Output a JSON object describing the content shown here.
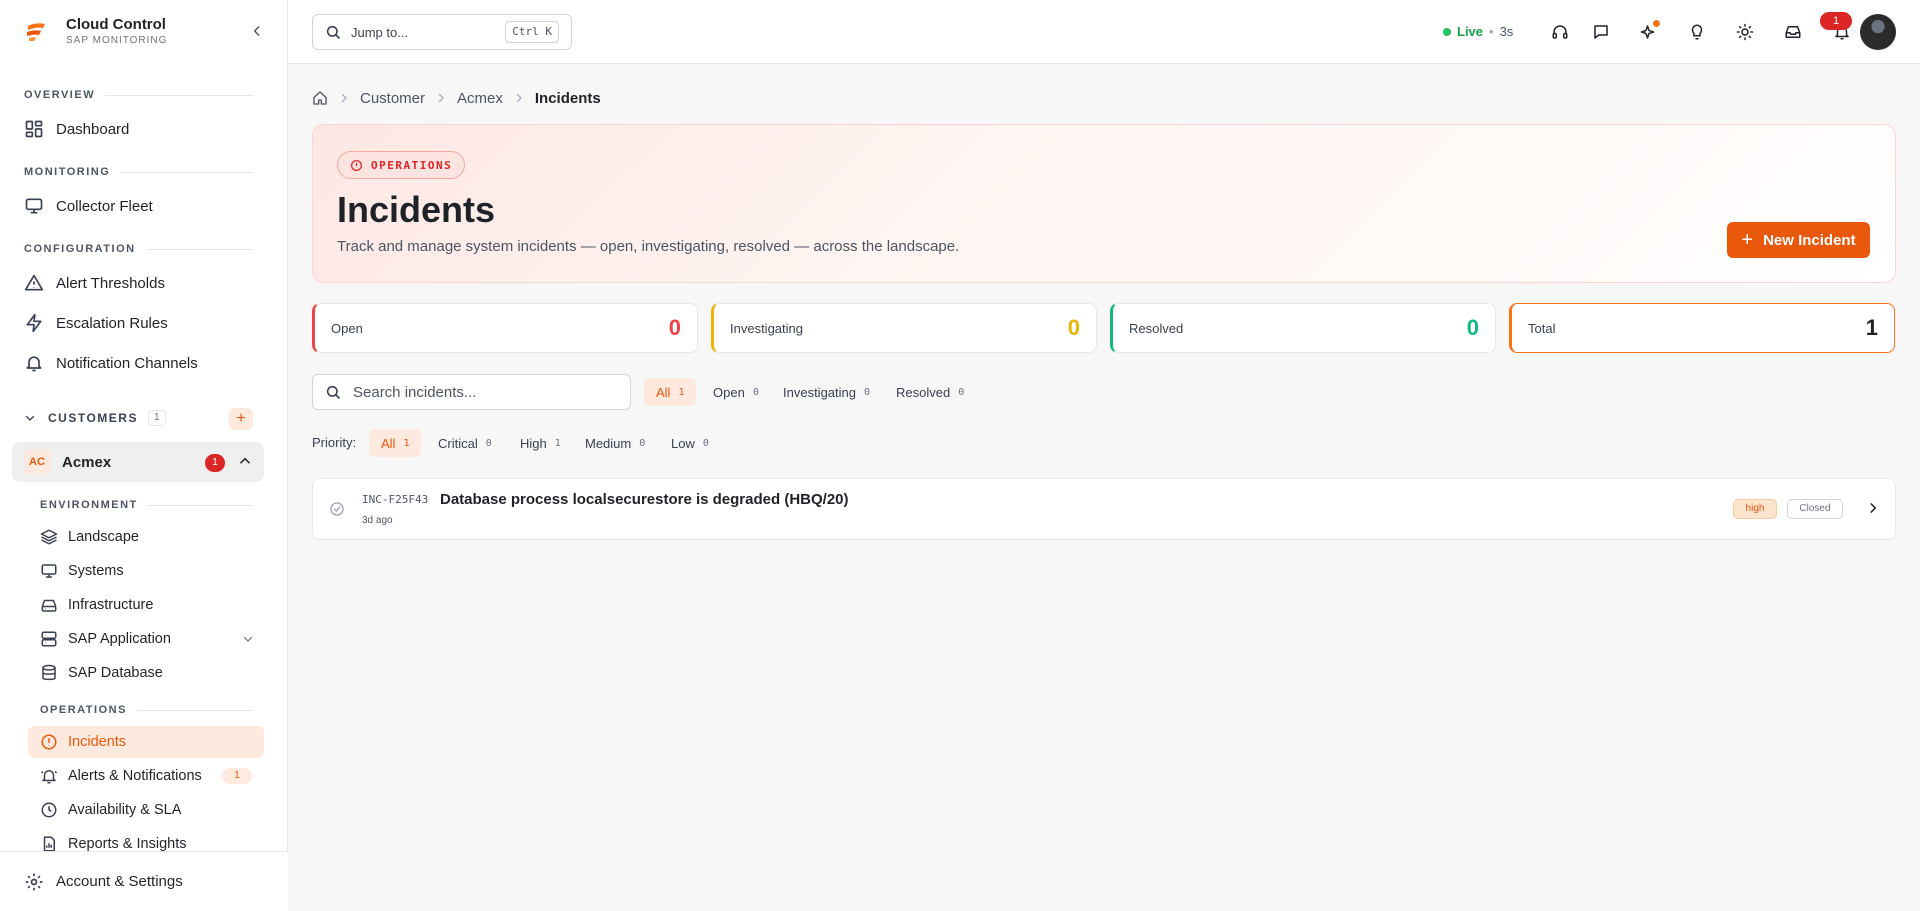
{
  "brand": {
    "title": "Cloud Control",
    "subtitle": "SAP MONITORING"
  },
  "sidebar": {
    "overview_label": "OVERVIEW",
    "monitoring_label": "MONITORING",
    "configuration_label": "CONFIGURATION",
    "items": {
      "dashboard": "Dashboard",
      "collector_fleet": "Collector Fleet",
      "alert_thresholds": "Alert Thresholds",
      "escalation_rules": "Escalation Rules",
      "notification_channels": "Notification Channels"
    },
    "customers": {
      "label": "CUSTOMERS",
      "count": "1",
      "add": "+"
    },
    "customer": {
      "initials": "AC",
      "name": "Acmex",
      "badge": "1"
    },
    "environment_label": "ENVIRONMENT",
    "environment": {
      "landscape": "Landscape",
      "systems": "Systems",
      "infrastructure": "Infrastructure",
      "sap_application": "SAP Application",
      "sap_database": "SAP Database"
    },
    "operations_label": "OPERATIONS",
    "operations": {
      "incidents": "Incidents",
      "alerts": "Alerts & Notifications",
      "alerts_count": "1",
      "availability": "Availability & SLA",
      "reports": "Reports & Insights"
    },
    "account": "Account & Settings"
  },
  "topbar": {
    "jump_placeholder": "Jump to...",
    "jump_shortcut": "Ctrl K",
    "live_label": "Live",
    "live_sep": "•",
    "live_age": "3s",
    "notification_count": "1"
  },
  "breadcrumb": {
    "items": [
      "Customer",
      "Acmex"
    ],
    "current": "Incidents"
  },
  "hero": {
    "tag": "OPERATIONS",
    "title": "Incidents",
    "subtitle": "Track and manage system incidents — open, investigating, resolved — across the landscape.",
    "new_button": "New Incident"
  },
  "stats": [
    {
      "label": "Open",
      "value": "0",
      "color": "#ef4444"
    },
    {
      "label": "Investigating",
      "value": "0",
      "color": "#eab308"
    },
    {
      "label": "Resolved",
      "value": "0",
      "color": "#10b981"
    },
    {
      "label": "Total",
      "value": "1",
      "color": "#1f2328",
      "accent": "#f97316"
    }
  ],
  "search": {
    "placeholder": "Search incidents..."
  },
  "status_filters": [
    {
      "label": "All",
      "count": "1"
    },
    {
      "label": "Open",
      "count": "0"
    },
    {
      "label": "Investigating",
      "count": "0"
    },
    {
      "label": "Resolved",
      "count": "0"
    }
  ],
  "priority": {
    "label": "Priority:",
    "filters": [
      {
        "label": "All",
        "count": "1"
      },
      {
        "label": "Critical",
        "count": "0"
      },
      {
        "label": "High",
        "count": "1"
      },
      {
        "label": "Medium",
        "count": "0"
      },
      {
        "label": "Low",
        "count": "0"
      }
    ]
  },
  "incidents": [
    {
      "id": "INC-F25F43",
      "title": "Database process localsecurestore is degraded (HBQ/20)",
      "age": "3d ago",
      "priority": "high",
      "status": "Closed"
    }
  ],
  "colors": {
    "accent": "#ea580c",
    "danger": "#dc2626",
    "live": "#22c55e"
  }
}
